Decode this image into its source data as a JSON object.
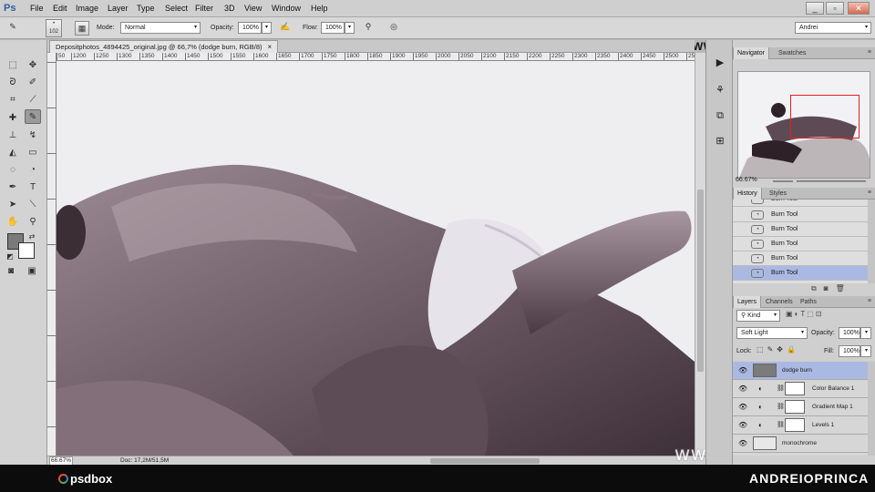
{
  "app": {
    "logo": "Ps",
    "menus": [
      "File",
      "Edit",
      "Image",
      "Layer",
      "Type",
      "Select",
      "Filter",
      "3D",
      "View",
      "Window",
      "Help"
    ],
    "window_controls": [
      "_",
      "▫",
      "✕"
    ]
  },
  "options": {
    "brush_size": "102",
    "mode_label": "Mode:",
    "mode_value": "Normal",
    "opacity_label": "Opacity:",
    "opacity_value": "100%",
    "flow_label": "Flow:",
    "flow_value": "100%",
    "workspace": "Andrei"
  },
  "brand_text": "WWW.PSDBOX.COM",
  "document": {
    "tab_title": "Depositphotos_4894425_original.jpg @ 66,7% (dodge burn, RGB/8)",
    "tab_close": "×",
    "zoom": "66.67%",
    "doc_info": "Doc: 17,2M/51,5M"
  },
  "ruler": {
    "ticks": [
      "50",
      "1200",
      "1250",
      "1300",
      "1350",
      "1400",
      "1450",
      "1500",
      "1550",
      "1600",
      "1650",
      "1700",
      "1750",
      "1800",
      "1850",
      "1900",
      "1950",
      "2000",
      "2050",
      "2100",
      "2150",
      "2200",
      "2250",
      "2300",
      "2350",
      "2400",
      "2450",
      "2500",
      "2550"
    ]
  },
  "navigator": {
    "tab": "Navigator",
    "tab2": "Swatches",
    "zoom": "66.67%"
  },
  "history": {
    "tab": "History",
    "tab2": "Styles",
    "items": [
      "Burn Tool",
      "Burn Tool",
      "Burn Tool",
      "Burn Tool",
      "Burn Tool",
      "Burn Tool"
    ],
    "active_index": 5
  },
  "layers": {
    "tab": "Layers",
    "tab2": "Channels",
    "tab3": "Paths",
    "kind": "Kind",
    "blend": "Soft Light",
    "opacity_label": "Opacity:",
    "opacity": "100%",
    "lock_label": "Lock:",
    "fill_label": "Fill:",
    "fill": "100%",
    "items": [
      {
        "name": "dodge burn",
        "active": true
      },
      {
        "name": "Color Balance 1",
        "active": false
      },
      {
        "name": "Gradient Map 1",
        "active": false
      },
      {
        "name": "Levels 1",
        "active": false
      },
      {
        "name": "monochrome",
        "active": false
      }
    ]
  },
  "watermark": "www.hupis.com",
  "footer": {
    "logo": "psdbox",
    "author": "ANDREIOPRINCA"
  },
  "colors": {
    "accent": "#aab9e2",
    "nav_rect": "#e02020"
  }
}
